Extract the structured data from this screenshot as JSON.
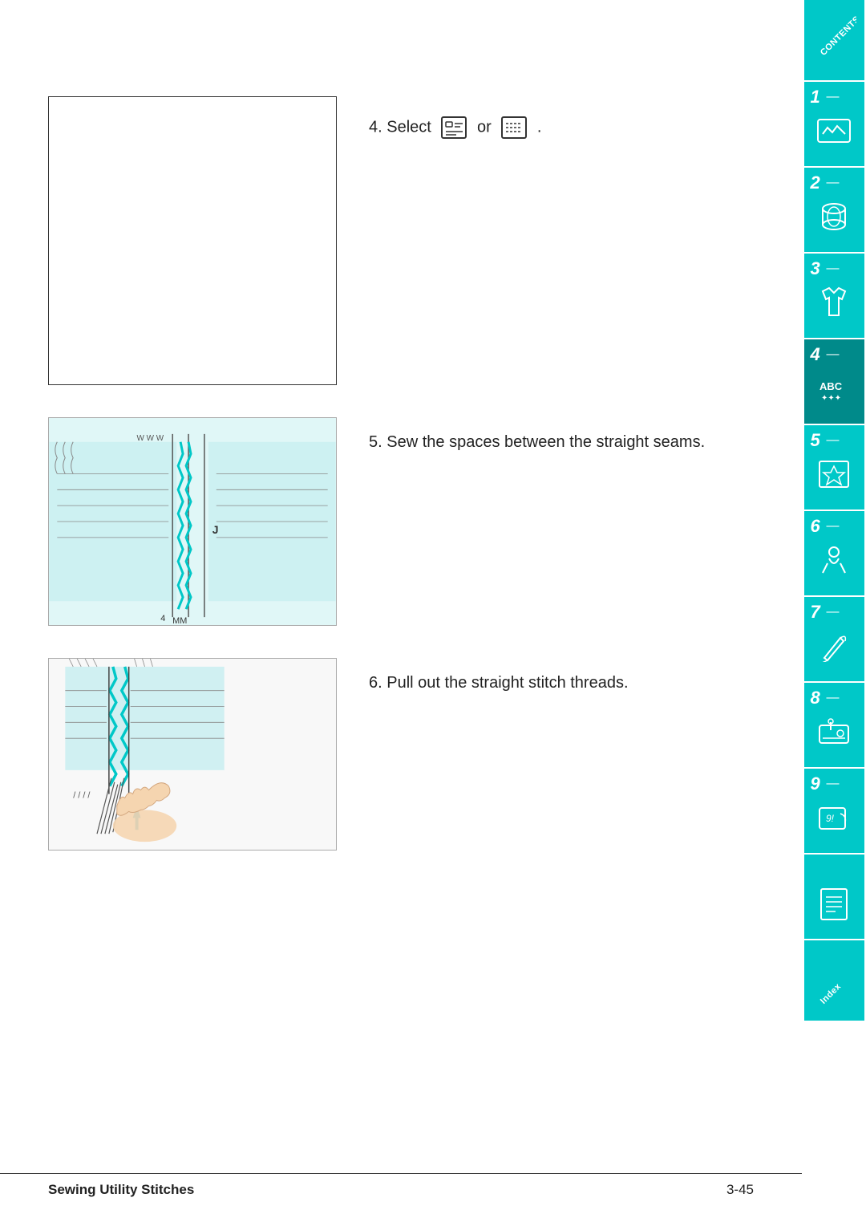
{
  "footer": {
    "title": "Sewing Utility Stitches",
    "page": "3-45"
  },
  "steps": {
    "step4": {
      "number": "4.",
      "text_before": "Select",
      "connector": "or",
      "text_after": "."
    },
    "step5": {
      "number": "5.",
      "text": "Sew the spaces between the straight seams."
    },
    "step6": {
      "number": "6.",
      "text": "Pull out the straight stitch threads."
    }
  },
  "sidebar": {
    "contents_label": "CONTENTS",
    "index_label": "Index",
    "items": [
      {
        "number": "1",
        "label": ""
      },
      {
        "number": "2",
        "label": ""
      },
      {
        "number": "3",
        "label": ""
      },
      {
        "number": "4",
        "label": ""
      },
      {
        "number": "5",
        "label": ""
      },
      {
        "number": "6",
        "label": ""
      },
      {
        "number": "7",
        "label": ""
      },
      {
        "number": "8",
        "label": ""
      },
      {
        "number": "9",
        "label": ""
      }
    ]
  }
}
